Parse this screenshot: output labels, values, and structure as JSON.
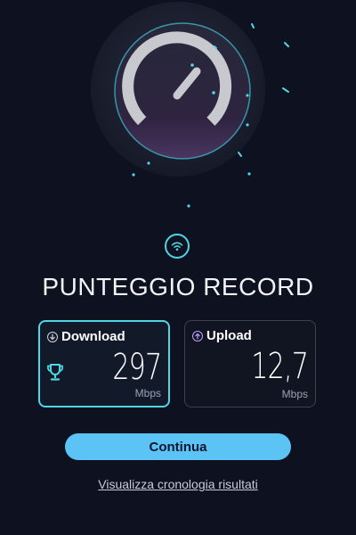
{
  "hero": {
    "icon": "speedometer-icon",
    "accent": "#4fd6e4"
  },
  "status_icon": "wifi-icon",
  "record": {
    "title": "PUNTEGGIO RECORD"
  },
  "download": {
    "label": "Download",
    "value": "297",
    "unit": "Mbps",
    "icon": "arrow-down-circle-icon",
    "badge_icon": "trophy-icon",
    "accent": "#4fd6e4"
  },
  "upload": {
    "label": "Upload",
    "value": "12,7",
    "unit": "Mbps",
    "icon": "arrow-up-circle-icon",
    "accent": "#c59cff"
  },
  "actions": {
    "continue_label": "Continua",
    "history_label": "Visualizza cronologia risultati",
    "primary_color": "#5cc4f5"
  }
}
